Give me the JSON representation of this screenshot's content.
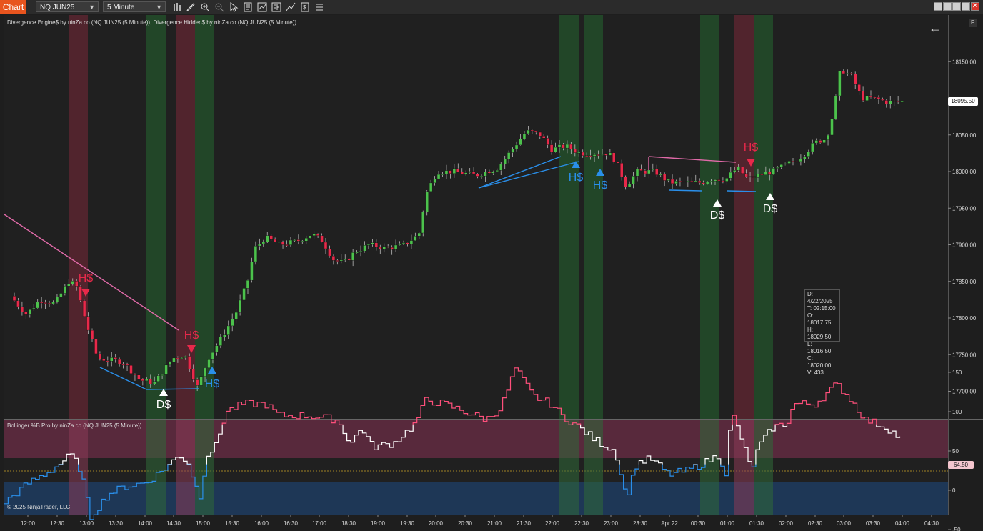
{
  "toolbar": {
    "tab_label": "Chart",
    "instrument": "NQ JUN25",
    "interval": "5 Minute",
    "icons": [
      "bar-style-icon",
      "draw-pencil-icon",
      "zoom-in-icon",
      "zoom-out-icon",
      "pointer-icon",
      "properties-icon",
      "indicators-icon",
      "strategies-icon",
      "template-icon",
      "data-box-icon"
    ],
    "window_buttons": [
      "tile-icon",
      "minimize-icon",
      "restore-icon",
      "close-icon"
    ]
  },
  "main_panel": {
    "legend": "Divergence Engine$ by ninZa.co (NQ JUN25 (5 Minute)), Divergence Hidden$ by ninZa.co (NQ JUN25 (5 Minute))",
    "price_ticks": [
      "18150.00",
      "18050.00",
      "18000.00",
      "17950.00",
      "17900.00",
      "17850.00",
      "17800.00",
      "17750.00",
      "17700.00"
    ],
    "last_price": "18095.50",
    "signals": [
      {
        "label": "H$",
        "color": "#e8294a"
      },
      {
        "label": "H$",
        "color": "#e8294a"
      },
      {
        "label": "H$",
        "color": "#2a8fea"
      },
      {
        "label": "D$",
        "color": "#ffffff"
      },
      {
        "label": "H$",
        "color": "#2a8fea"
      },
      {
        "label": "H$",
        "color": "#2a8fea"
      },
      {
        "label": "H$",
        "color": "#e8294a"
      },
      {
        "label": "D$",
        "color": "#ffffff"
      },
      {
        "label": "D$",
        "color": "#ffffff"
      }
    ]
  },
  "data_box": {
    "lines": [
      "D: 4/22/2025",
      "T: 02:15:00",
      "O: 18017.75",
      "H: 18029.50",
      "L: 18016.50",
      "C: 18020.00",
      "V: 433"
    ]
  },
  "sub_panel": {
    "legend": "Bollinger %B Pro by ninZa.co (NQ JUN25 (5 Minute))",
    "ticks": [
      "150",
      "100",
      "50",
      "0",
      "-50"
    ],
    "current_value": "64.50"
  },
  "time_axis": [
    "12:00",
    "12:30",
    "13:00",
    "13:30",
    "14:00",
    "14:30",
    "15:00",
    "15:30",
    "16:00",
    "16:30",
    "17:00",
    "18:30",
    "19:00",
    "19:30",
    "20:00",
    "20:30",
    "21:00",
    "21:30",
    "22:00",
    "22:30",
    "23:00",
    "23:30",
    "Apr 22",
    "00:30",
    "01:00",
    "01:30",
    "02:00",
    "02:30",
    "03:00",
    "03:30",
    "04:00",
    "04:30"
  ],
  "copyright": "© 2025 NinjaTrader, LLC",
  "colors": {
    "up": "#4cc24c",
    "down": "#e8294a",
    "bull_div": "#2a8fea",
    "bear_div": "#e06aa8",
    "bg": "#1e1e1e"
  }
}
